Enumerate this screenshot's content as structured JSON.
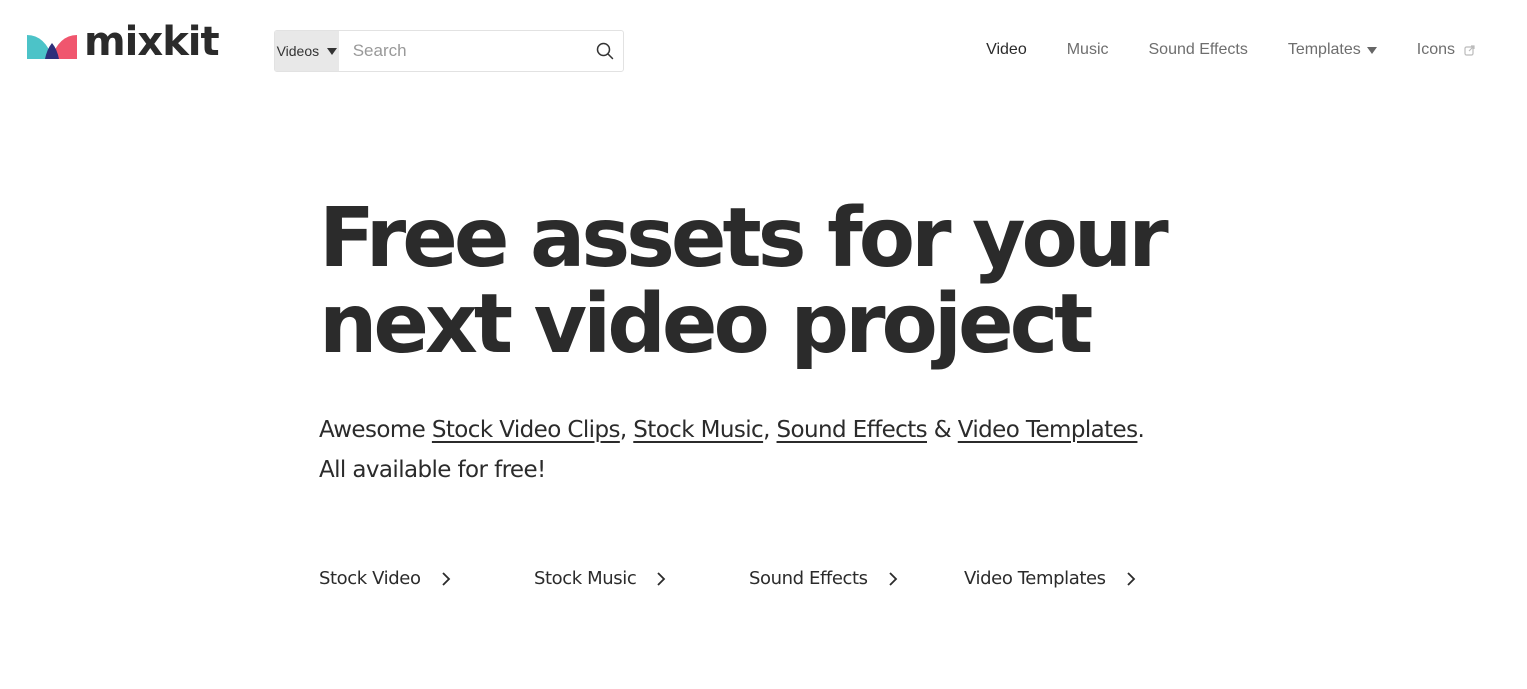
{
  "brand": {
    "name": "mixkit",
    "colors": {
      "teal": "#4cc3c8",
      "coral": "#f0566e",
      "navy": "#2d2f7a"
    }
  },
  "search": {
    "category_selected": "Videos",
    "placeholder": "Search",
    "value": "",
    "icon": "search-icon"
  },
  "nav": {
    "items": [
      {
        "label": "Video",
        "active": true
      },
      {
        "label": "Music"
      },
      {
        "label": "Sound Effects"
      },
      {
        "label": "Templates",
        "icon": "caret-down-icon"
      },
      {
        "label": "Icons",
        "icon": "external-link-icon"
      }
    ]
  },
  "hero": {
    "title_line1": "Free assets for your",
    "title_line2": "next video project",
    "tagline": {
      "prefix": "Awesome ",
      "links": [
        "Stock Video Clips",
        "Stock Music",
        "Sound Effects",
        "Video Templates"
      ],
      "sep1": ", ",
      "sep2": ", ",
      "sep3": " & ",
      "end": ".",
      "line2": "All available for free!"
    }
  },
  "categories": [
    {
      "label": "Stock Video",
      "icon": "chevron-right-icon"
    },
    {
      "label": "Stock Music",
      "icon": "chevron-right-icon"
    },
    {
      "label": "Sound Effects",
      "icon": "chevron-right-icon"
    },
    {
      "label": "Video Templates",
      "icon": "chevron-right-icon"
    }
  ]
}
